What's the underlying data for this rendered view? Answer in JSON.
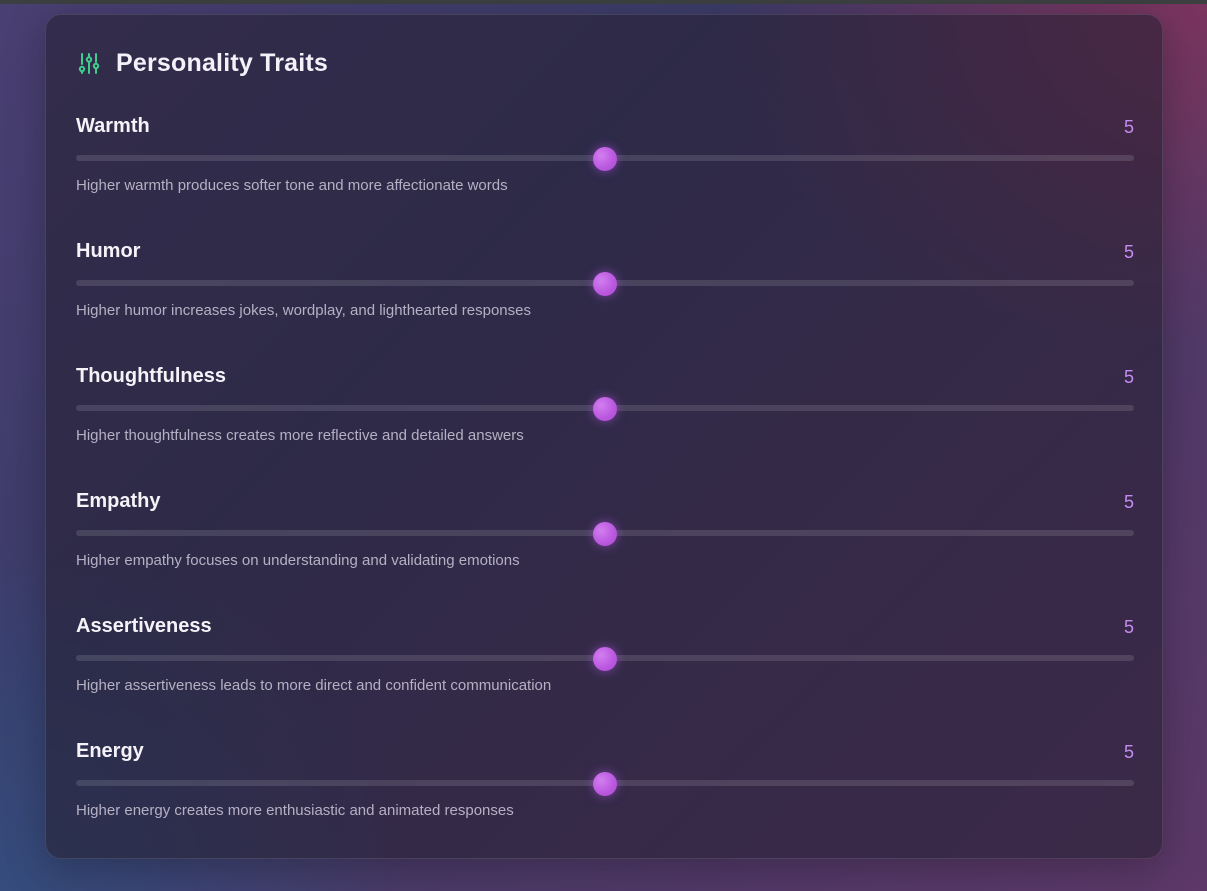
{
  "panel": {
    "title": "Personality Traits",
    "icon": "sliders-icon",
    "accent_color": "#c58cf2",
    "icon_color": "#3ecf8e"
  },
  "traits": [
    {
      "label": "Warmth",
      "value": "5",
      "level": 5,
      "max": 10,
      "description": "Higher warmth produces softer tone and more affectionate words"
    },
    {
      "label": "Humor",
      "value": "5",
      "level": 5,
      "max": 10,
      "description": "Higher humor increases jokes, wordplay, and lighthearted responses"
    },
    {
      "label": "Thoughtfulness",
      "value": "5",
      "level": 5,
      "max": 10,
      "description": "Higher thoughtfulness creates more reflective and detailed answers"
    },
    {
      "label": "Empathy",
      "value": "5",
      "level": 5,
      "max": 10,
      "description": "Higher empathy focuses on understanding and validating emotions"
    },
    {
      "label": "Assertiveness",
      "value": "5",
      "level": 5,
      "max": 10,
      "description": "Higher assertiveness leads to more direct and confident communication"
    },
    {
      "label": "Energy",
      "value": "5",
      "level": 5,
      "max": 10,
      "description": "Higher energy creates more enthusiastic and animated responses"
    }
  ]
}
